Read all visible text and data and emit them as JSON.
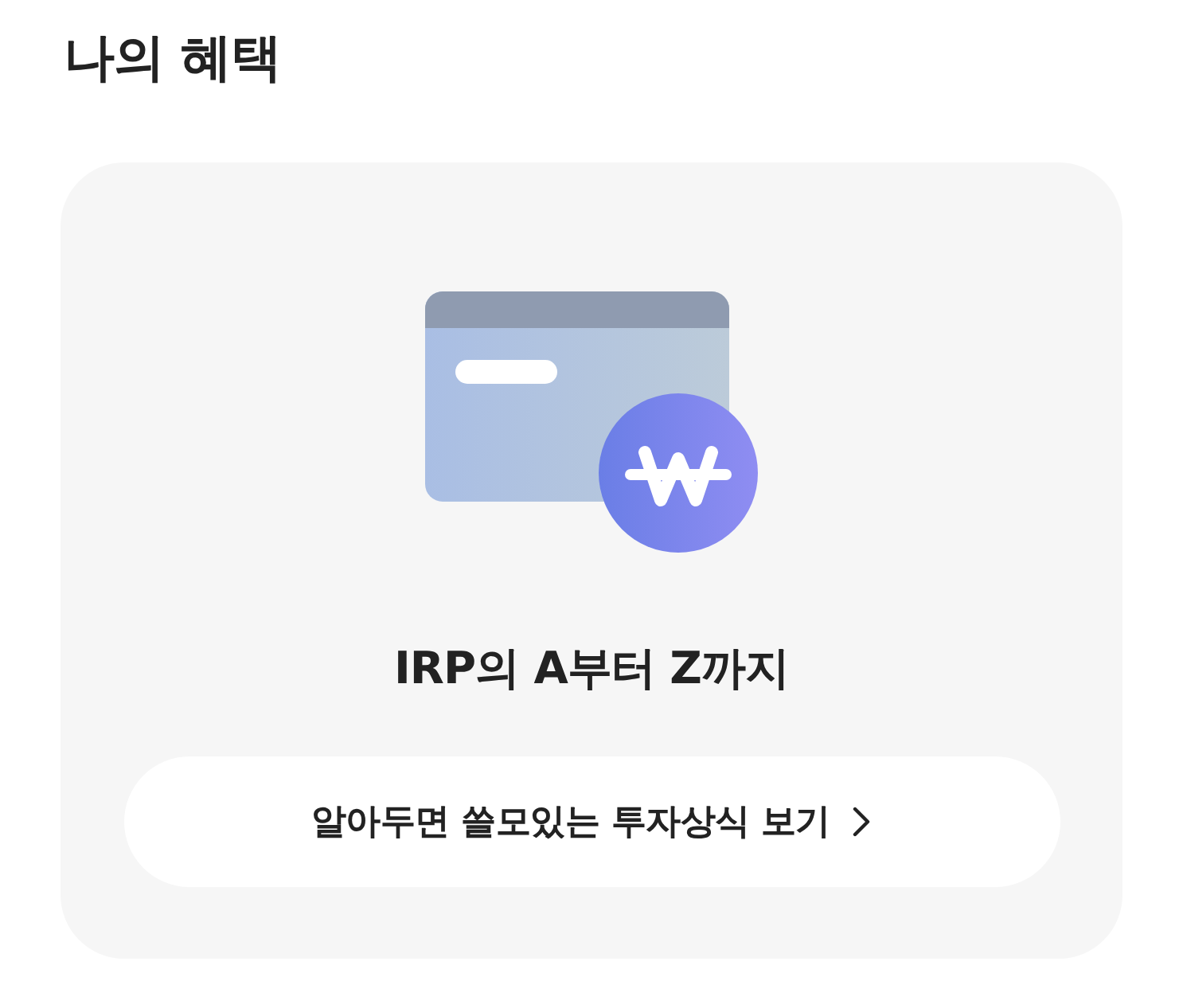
{
  "header": {
    "title": "나의 혜택"
  },
  "benefit_card": {
    "heading": "IRP의 A부터 Z까지",
    "link_button": {
      "label": "알아두면 쓸모있는 투자상식 보기"
    }
  }
}
